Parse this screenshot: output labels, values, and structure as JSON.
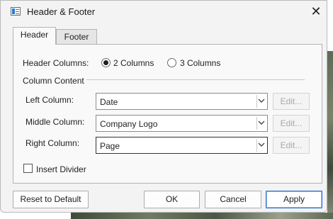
{
  "window": {
    "title": "Header & Footer",
    "close_glyph": "✕"
  },
  "tabs": [
    {
      "label": "Header",
      "active": true
    },
    {
      "label": "Footer",
      "active": false
    }
  ],
  "header_columns": {
    "label": "Header Columns:",
    "options": [
      {
        "label": "2 Columns",
        "selected": true
      },
      {
        "label": "3 Columns",
        "selected": false
      }
    ]
  },
  "column_content": {
    "group_label": "Column Content",
    "rows": [
      {
        "label": "Left Column:",
        "value": "Date",
        "edit_label": "Edit..."
      },
      {
        "label": "Middle Column:",
        "value": "Company Logo",
        "edit_label": "Edit..."
      },
      {
        "label": "Right Column:",
        "value": "Page",
        "edit_label": "Edit..."
      }
    ]
  },
  "insert_divider": {
    "label": "Insert Divider",
    "checked": false
  },
  "buttons": {
    "reset": "Reset to Default",
    "ok": "OK",
    "cancel": "Cancel",
    "apply": "Apply"
  },
  "colors": {
    "dialog_bg": "#f3f3f3",
    "panel_bg": "#f9f9f9",
    "default_button_border": "#2b6fd0",
    "disabled_text": "#a8a8a8"
  }
}
